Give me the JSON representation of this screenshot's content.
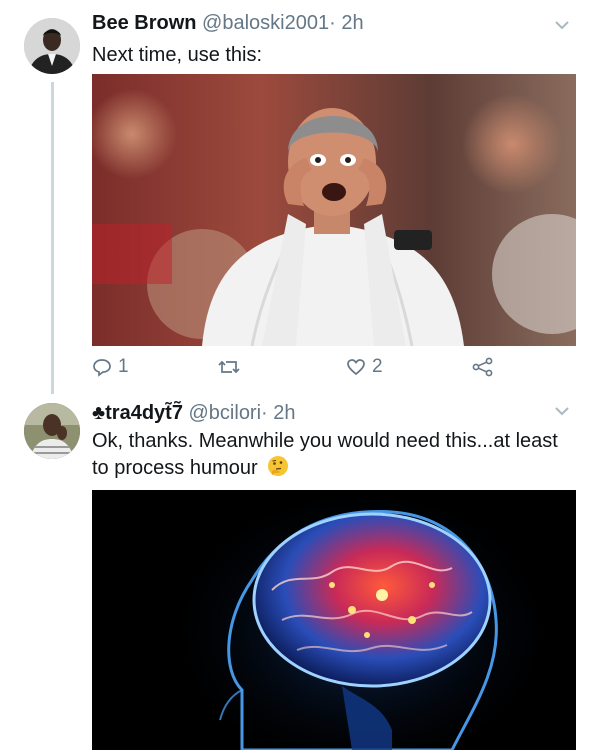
{
  "tweets": [
    {
      "name": "Bee Brown",
      "handle": "@baloski2001",
      "separator": "·",
      "time": "2h",
      "text": "Next time, use this:",
      "image": "photo of man gesturing at his eyes",
      "actions": {
        "reply_count": "1",
        "retweet_count": "",
        "like_count": "2"
      }
    },
    {
      "name": "♣tra4dyt̃7̃",
      "handle": "@bcilori",
      "separator": "·",
      "time": "2h",
      "text": "Ok, thanks. Meanwhile you would need this...at least to process humour",
      "emoji": "thinking-face-emoji",
      "image": "glowing brain illustration"
    }
  ],
  "colors": {
    "text": "#14171a",
    "secondary": "#657786",
    "thread_line": "#ccd6dd",
    "background": "#ffffff"
  },
  "icons": [
    "reply-icon",
    "retweet-icon",
    "heart-icon",
    "share-icon",
    "chevron-down-icon"
  ]
}
